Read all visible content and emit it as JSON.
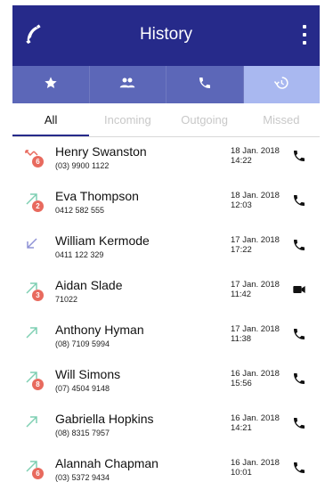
{
  "appbar": {
    "title": "History",
    "left_icon": "phone-handset-icon",
    "right_icon": "more-vert-icon",
    "color": "#262a8a"
  },
  "icon_tabs": [
    {
      "icon": "star-icon",
      "selected": false
    },
    {
      "icon": "contacts-icon",
      "selected": false
    },
    {
      "icon": "phone-icon",
      "selected": false
    },
    {
      "icon": "history-icon",
      "selected": true
    }
  ],
  "filters": {
    "all": "All",
    "incoming": "Incoming",
    "outgoing": "Outgoing",
    "missed": "Missed",
    "active": "all"
  },
  "calls": [
    {
      "name": "Henry Swanston",
      "number": "(03) 9900 1122",
      "date": "18 Jan. 2018",
      "time": "14:22",
      "direction": "missed",
      "badge": "6",
      "action": "phone"
    },
    {
      "name": "Eva Thompson",
      "number": "0412 582 555",
      "date": "18 Jan. 2018",
      "time": "12:03",
      "direction": "outgoing",
      "badge": "2",
      "action": "phone"
    },
    {
      "name": "William Kermode",
      "number": "0411 122 329",
      "date": "17 Jan. 2018",
      "time": "17:22",
      "direction": "incoming",
      "badge": "",
      "action": "phone"
    },
    {
      "name": "Aidan Slade",
      "number": "71022",
      "date": "17 Jan. 2018",
      "time": "11:42",
      "direction": "outgoing",
      "badge": "3",
      "action": "video"
    },
    {
      "name": "Anthony Hyman",
      "number": "(08) 7109 5994",
      "date": "17 Jan. 2018",
      "time": "11:38",
      "direction": "outgoing",
      "badge": "",
      "action": "phone"
    },
    {
      "name": "Will Simons",
      "number": "(07) 4504 9148",
      "date": "16 Jan. 2018",
      "time": "15:56",
      "direction": "outgoing",
      "badge": "8",
      "action": "phone"
    },
    {
      "name": "Gabriella Hopkins",
      "number": "(08) 8315 7957",
      "date": "16 Jan. 2018",
      "time": "14:21",
      "direction": "outgoing",
      "badge": "",
      "action": "phone"
    },
    {
      "name": "Alannah Chapman",
      "number": "(03) 5372 9434",
      "date": "16 Jan. 2018",
      "time": "10:01",
      "direction": "outgoing",
      "badge": "6",
      "action": "phone"
    }
  ],
  "colors": {
    "missed": "#e86a5e",
    "outgoing": "#7fcfb3",
    "incoming": "#8f93d6",
    "iconbar": "#5c67b8",
    "iconbar_selected": "#a9b8f0"
  }
}
